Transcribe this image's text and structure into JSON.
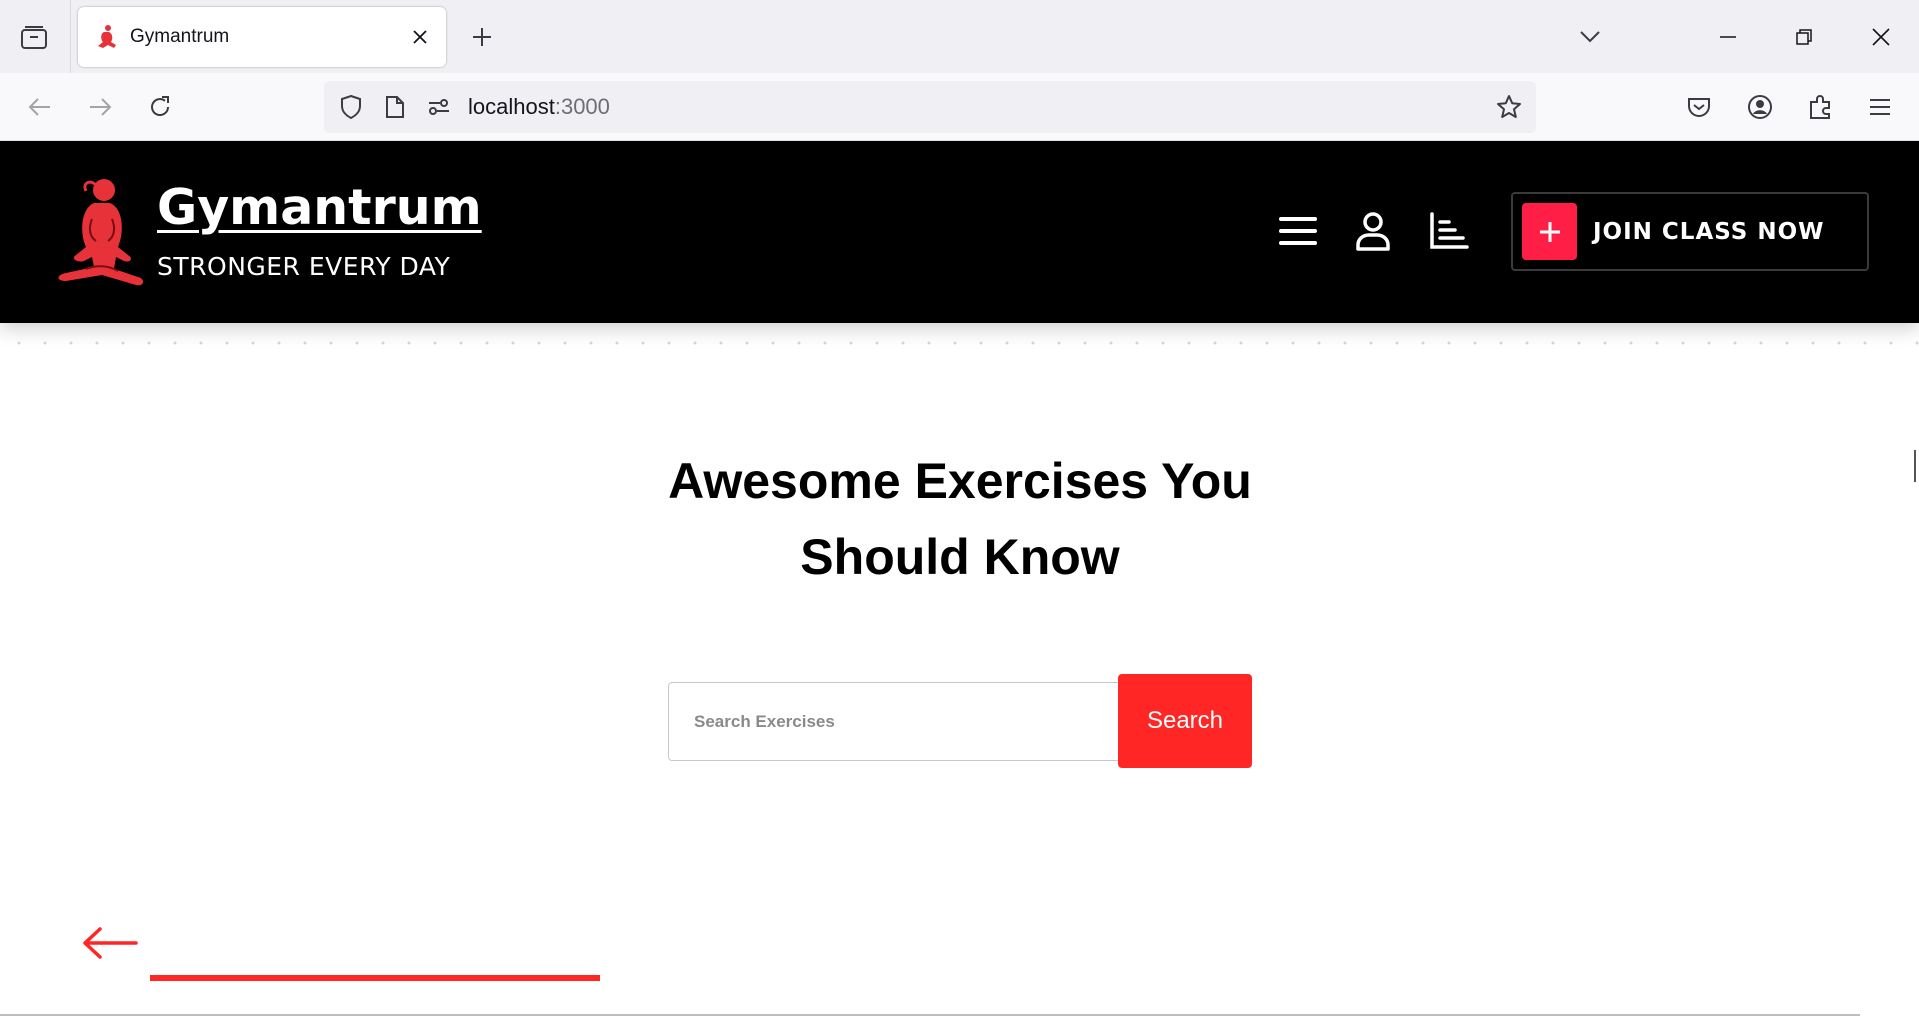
{
  "browser": {
    "tab": {
      "title": "Gymantrum"
    },
    "url": {
      "host": "localhost",
      "port": ":3000"
    }
  },
  "header": {
    "brand": "Gymantrum",
    "tagline": "STRONGER EVERY DAY",
    "join_button": "JOIN CLASS NOW"
  },
  "main": {
    "headline_line1": "Awesome Exercises You",
    "headline_line2": "Should Know",
    "search": {
      "placeholder": "Search Exercises",
      "value": "",
      "button": "Search"
    }
  },
  "colors": {
    "accent": "#ff2625",
    "join_plus": "#ff1e46",
    "header_bg": "#000000"
  },
  "icons": [
    "tab-list-icon",
    "close-icon",
    "plus-icon",
    "chevron-down-icon",
    "minimize-icon",
    "restore-icon",
    "back-arrow-icon",
    "forward-arrow-icon",
    "reload-icon",
    "shield-icon",
    "page-icon",
    "permissions-icon",
    "star-icon",
    "pocket-icon",
    "account-icon",
    "extensions-icon",
    "hamburger-menu-icon",
    "user-icon",
    "chart-icon",
    "arrow-left-icon"
  ]
}
